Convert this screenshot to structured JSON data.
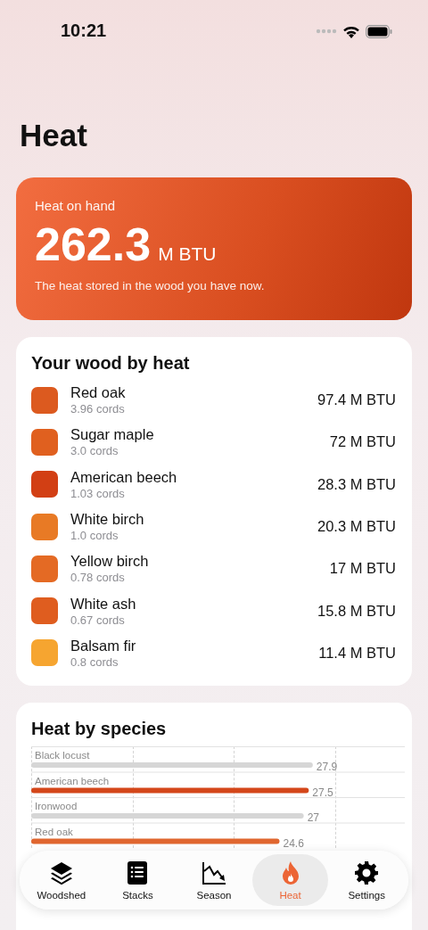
{
  "status_bar": {
    "time": "10:21"
  },
  "title": "Heat",
  "summary": {
    "label": "Heat on hand",
    "value": "262.3",
    "unit": "M BTU",
    "caption": "The heat stored in the wood you have now."
  },
  "wood_by_heat": {
    "title": "Your wood by heat",
    "items": [
      {
        "name": "Red oak",
        "amount": "3.96 cords",
        "heat": "97.4 M BTU",
        "color": "#dc5a1f"
      },
      {
        "name": "Sugar maple",
        "amount": "3.0 cords",
        "heat": "72 M BTU",
        "color": "#e0601f"
      },
      {
        "name": "American beech",
        "amount": "1.03 cords",
        "heat": "28.3 M BTU",
        "color": "#d23f14"
      },
      {
        "name": "White birch",
        "amount": "1.0 cords",
        "heat": "20.3 M BTU",
        "color": "#e87a25"
      },
      {
        "name": "Yellow birch",
        "amount": "0.78 cords",
        "heat": "17 M BTU",
        "color": "#e46a24"
      },
      {
        "name": "White ash",
        "amount": "0.67 cords",
        "heat": "15.8 M BTU",
        "color": "#df5d1f"
      },
      {
        "name": "Balsam fir",
        "amount": "0.8 cords",
        "heat": "11.4 M BTU",
        "color": "#f6a530"
      }
    ]
  },
  "heat_by_species": {
    "title": "Heat by species",
    "bars": [
      {
        "color": "#d6d6d6"
      },
      {
        "color": "#d4471a"
      },
      {
        "color": "#d6d6d6"
      },
      {
        "color": "#e0662f"
      }
    ],
    "chart_data": {
      "type": "bar",
      "orientation": "horizontal",
      "data_labels": true,
      "categories": [
        "Black locust",
        "American beech",
        "Ironwood",
        "Red oak"
      ],
      "values": [
        27.9,
        27.5,
        27,
        24.6
      ]
    }
  },
  "tabs": [
    {
      "label": "Woodshed",
      "selected": false
    },
    {
      "label": "Stacks",
      "selected": false
    },
    {
      "label": "Season",
      "selected": false
    },
    {
      "label": "Heat",
      "selected": true
    },
    {
      "label": "Settings",
      "selected": false
    }
  ]
}
